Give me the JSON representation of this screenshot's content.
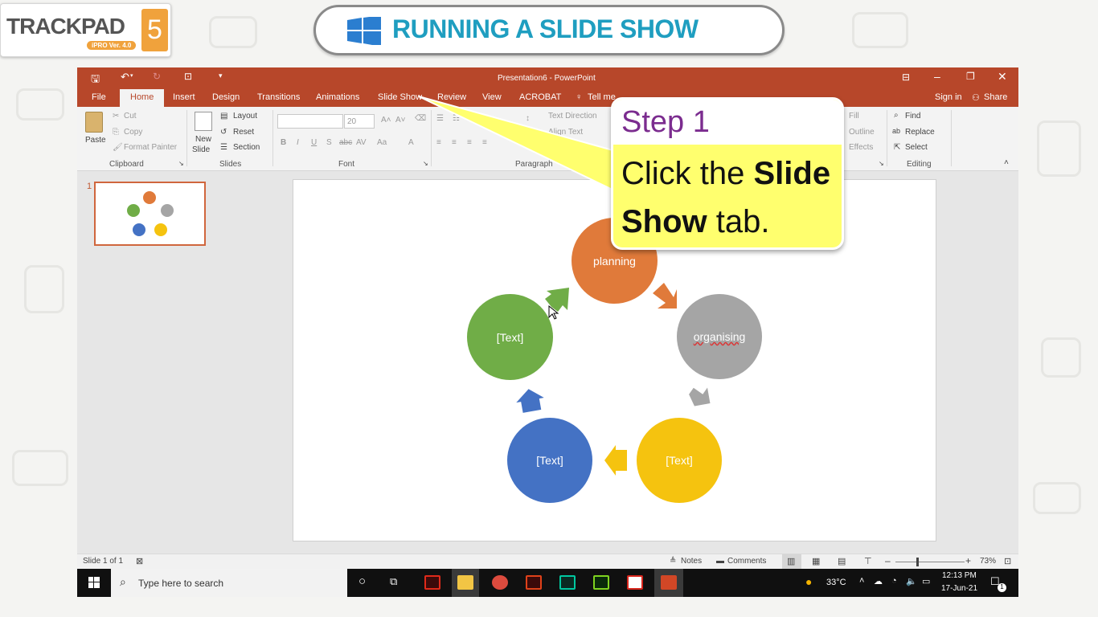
{
  "header": {
    "logo_text": "TRACKPAD",
    "logo_number": "5",
    "logo_version": "iPRO Ver. 4.0",
    "title": "RUNNING A SLIDE SHOW"
  },
  "window": {
    "title": "Presentation6 - PowerPoint"
  },
  "tabs": [
    "File",
    "Home",
    "Insert",
    "Design",
    "Transitions",
    "Animations",
    "Slide Show",
    "Review",
    "View",
    "ACROBAT"
  ],
  "tellme": "Tell me",
  "account": {
    "signin": "Sign in",
    "share": "Share"
  },
  "clipboard": {
    "paste": "Paste",
    "cut": "Cut",
    "copy": "Copy",
    "format_painter": "Format Painter",
    "group": "Clipboard"
  },
  "slides_group": {
    "new_slide": "New",
    "new_slide2": "Slide",
    "layout": "Layout",
    "reset": "Reset",
    "section": "Section",
    "group": "Slides"
  },
  "font_group": {
    "size": "20",
    "group": "Font"
  },
  "paragraph_group": {
    "text_direction": "Text Direction",
    "align_text": "Align Text",
    "group": "Paragraph"
  },
  "drawing": {
    "fill": "Fill",
    "outline": "Outline",
    "effects": "Effects"
  },
  "editing": {
    "find": "Find",
    "replace": "Replace",
    "select": "Select",
    "group": "Editing"
  },
  "thumb_number": "1",
  "diagram": {
    "top": "planning",
    "right": "organising",
    "bottom_right": "[Text]",
    "bottom_left": "[Text]",
    "left": "[Text]"
  },
  "callout": {
    "step": "Step 1",
    "pre": "Click the ",
    "bold1": "Slide",
    "bold2": "Show",
    "post": " tab."
  },
  "status": {
    "slide_info": "Slide 1 of 1",
    "notes": "Notes",
    "comments": "Comments",
    "zoom": "73%"
  },
  "taskbar": {
    "search_placeholder": "Type here to search",
    "weather": "33°C",
    "time": "12:13 PM",
    "date": "17-Jun-21",
    "notif_count": "1"
  },
  "colors": {
    "accent": "#b7472a",
    "planning": "#e07a3a",
    "organising": "#a5a5a5",
    "yellow": "#f5c30f",
    "blue": "#4472c4",
    "green": "#70ad47",
    "title_blue": "#1f9ec0",
    "callout": "#ffff6e"
  }
}
